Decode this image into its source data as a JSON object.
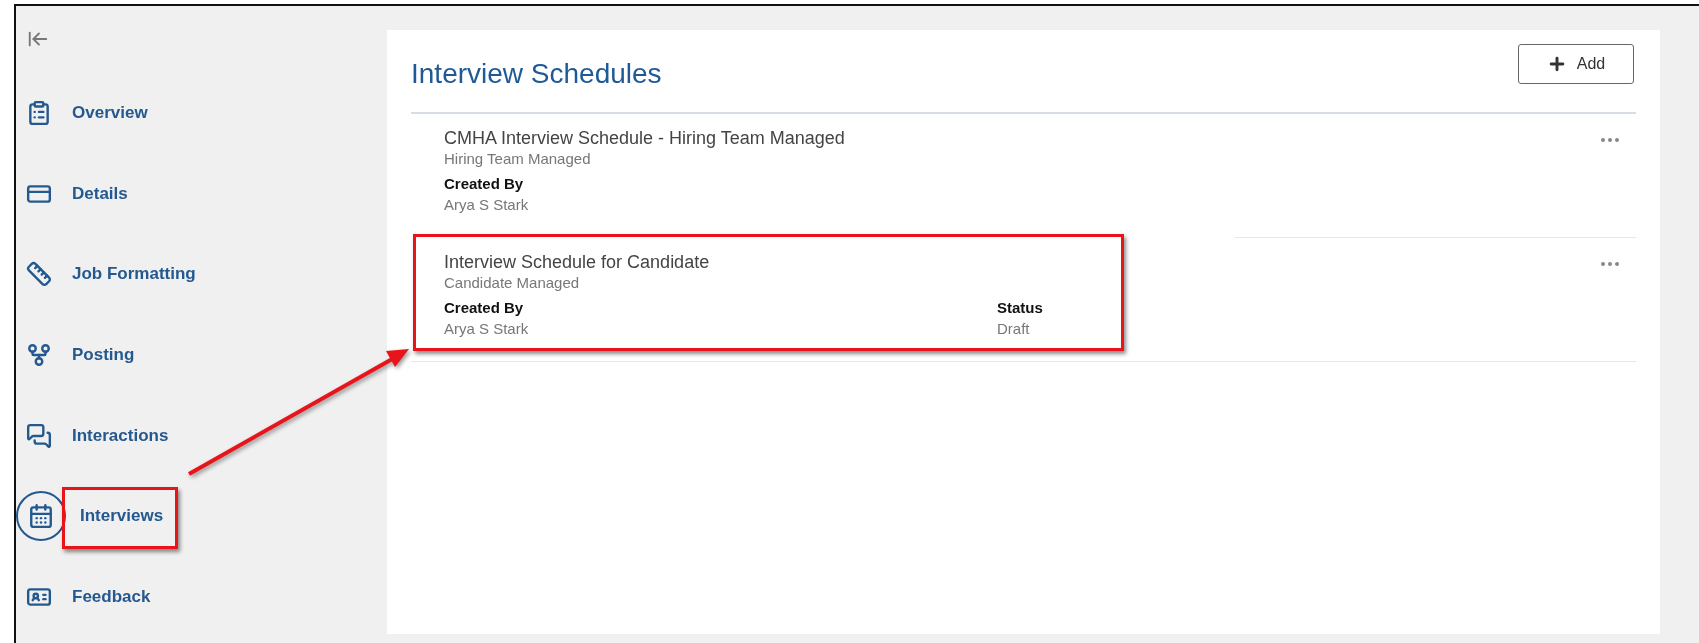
{
  "sidebar": {
    "items": [
      {
        "label": "Overview",
        "selected": false,
        "highlighted": false
      },
      {
        "label": "Details",
        "selected": false,
        "highlighted": false
      },
      {
        "label": "Job Formatting",
        "selected": false,
        "highlighted": false
      },
      {
        "label": "Posting",
        "selected": false,
        "highlighted": false
      },
      {
        "label": "Interactions",
        "selected": false,
        "highlighted": false
      },
      {
        "label": "Interviews",
        "selected": true,
        "highlighted": true
      },
      {
        "label": "Feedback",
        "selected": false,
        "highlighted": false
      }
    ]
  },
  "page": {
    "title": "Interview Schedules",
    "add_button": "Add"
  },
  "schedules": [
    {
      "title": "CMHA Interview Schedule - Hiring Team Managed",
      "subtitle": "Hiring Team Managed",
      "highlighted": false,
      "fields": [
        {
          "label": "Created By",
          "value": "Arya S Stark"
        }
      ]
    },
    {
      "title": "Interview Schedule for Candidate",
      "subtitle": "Candidate Managed",
      "highlighted": true,
      "fields": [
        {
          "label": "Created By",
          "value": "Arya S Stark"
        },
        {
          "label": "Status",
          "value": "Draft"
        }
      ]
    }
  ],
  "callout_arrow": true
}
